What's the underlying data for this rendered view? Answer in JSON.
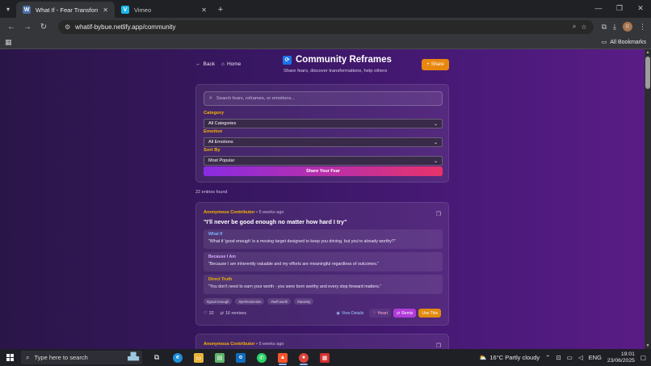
{
  "browser": {
    "tabs": [
      {
        "title": "What If - Fear Transformation A",
        "favicon": "W",
        "active": true
      },
      {
        "title": "Vimeo",
        "favicon": "V",
        "active": false
      }
    ],
    "url": "whatif-bybue.netlify.app/community",
    "all_bookmarks": "All Bookmarks",
    "profile_initial": "B"
  },
  "header": {
    "back": "Back",
    "home": "Home",
    "title": "Community Reframes",
    "subtitle": "Share fears, discover transformations, help others",
    "share": "Share"
  },
  "filters": {
    "search_placeholder": "Search fears, reframes, or emotions...",
    "category_label": "Category",
    "category_value": "All Categories",
    "emotion_label": "Emotion",
    "emotion_value": "All Emotions",
    "sort_label": "Sort By",
    "sort_value": "Most Popular",
    "share_fear": "Share Your Fear"
  },
  "entries_count": "22 entries found",
  "entries": [
    {
      "author": "Anonymous Contributor",
      "sep": "•",
      "time": "5 weeks ago",
      "quote": "\"I'll never be good enough no matter how hard I try\"",
      "what_if_label": "What If",
      "what_if_text": "\"What if 'good enough' is a moving target designed to keep you driving, but you're already worthy?\"",
      "because_label": "Because I Am",
      "because_text": "\"Because I am inherently valuable and my efforts are meaningful regardless of outcomes.\"",
      "truth_label": "Direct Truth",
      "truth_text": "\"You don't need to earn your worth - you were born worthy and every step forward matters.\"",
      "tags": [
        "#good enough",
        "#perfectionism",
        "#self worth",
        "#anxiety"
      ],
      "hearts": "32",
      "remixes": "16 remixes",
      "view_details": "View Details",
      "heart": "Heart",
      "remix": "Remix",
      "use_this": "Use This"
    },
    {
      "author": "Anonymous Contributor",
      "sep": "•",
      "time": "5 weeks ago"
    }
  ],
  "taskbar": {
    "search_placeholder": "Type here to search",
    "weather": "16°C  Partly cloudy",
    "language": "ENG",
    "time": "19:01",
    "date": "23/06/2025"
  },
  "colors": {
    "accent_gold": "#f5b400",
    "share_orange": "#e8870e",
    "remix_purple": "#b23bd9"
  }
}
